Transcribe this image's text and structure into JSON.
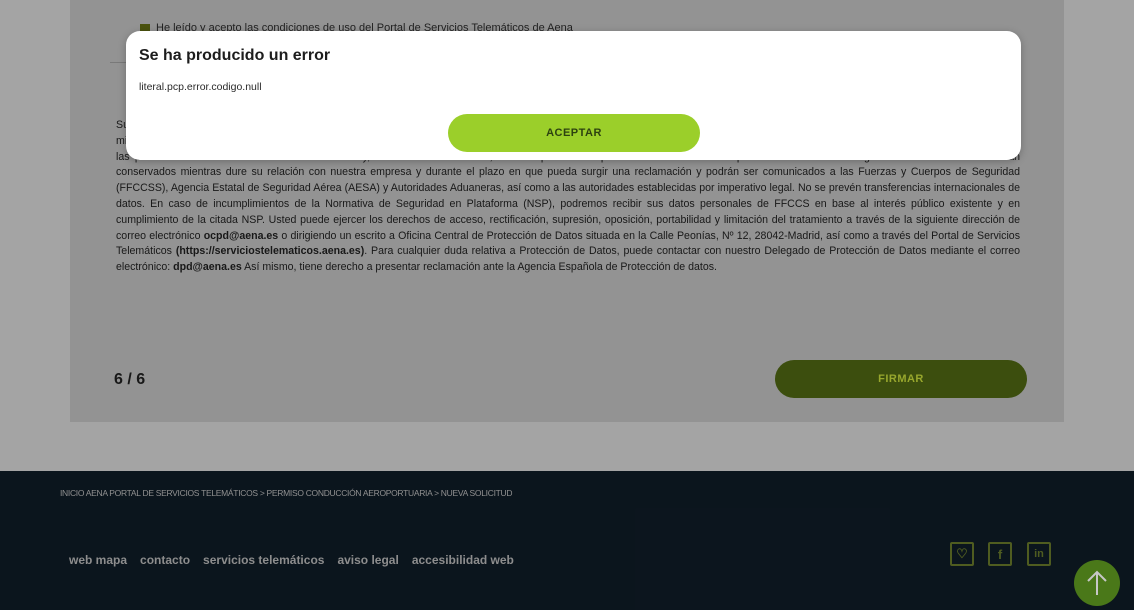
{
  "consent": {
    "checkbox_text": "He leído y acepto las condiciones de uso del Portal de Servicios Telemáticos de Aena"
  },
  "legal_text": {
    "p1": "Sus datos personales serán tratados por AENA S.M.E., S.A. como responsable del tratamiento, con la finalidad de gestionar la solicitud de su PCA y la documentación complementaria al mismo, con la finalidad de gestión y emisión de los PCA y créditos de conducción Aeroportuaria, necesarios para la correcta ejecución de su contrato laboral con AENA, S.M.E., S.A. o bien de las presentes condiciones de utilización del PCA y, en determinados casos, también para el cumplimiento de la normativa aplicable en materia de seguridad aérea. Los datos serán conservados mientras dure su relación con nuestra empresa y durante el plazo en que pueda surgir una reclamación y podrán ser comunicados a las Fuerzas y Cuerpos de Seguridad (FFCCSS), Agencia Estatal de Seguridad Aérea (AESA) y Autoridades Aduaneras, así como a las autoridades establecidas por imperativo legal. No se prevén transferencias internacionales de datos. En caso de incumplimientos de la Normativa de Seguridad en Plataforma (NSP), podremos recibir sus datos personales de FFCCS en base al interés público existente y en cumplimiento de la citada NSP. Usted puede ejercer los derechos de acceso, rectificación, supresión, oposición, portabilidad y limitación del tratamiento a través de la siguiente dirección de correo electrónico ",
    "email1": "ocpd@aena.es",
    "p2": " o dirigiendo un escrito a Oficina Central de Protección de Datos situada en la Calle Peonías, Nº 12, 28042-Madrid, así como a través del Portal de Servicios Telemáticos ",
    "portal_url": "(https://serviciostelematicos.aena.es)",
    "p3": ". Para cualquier duda relativa a Protección de Datos, puede contactar con nuestro Delegado de Protección de Datos mediante el correo electrónico: ",
    "email2": "dpd@aena.es",
    "p4": " Así mismo, tiene derecho a presentar reclamación ante la Agencia Española de Protección de datos."
  },
  "pager": {
    "label": "6 / 6"
  },
  "actions": {
    "sign_label": "FIRMAR"
  },
  "footer": {
    "breadcrumb": "INICIO AENA PORTAL DE SERVICIOS TELEMÁTICOS  >  PERMISO CONDUCCIÓN AEROPORTUARIA  >  NUEVA SOLICITUD",
    "links": [
      "web mapa",
      "contacto",
      "servicios telemáticos",
      "aviso legal",
      "accesibilidad web"
    ],
    "social_icons": [
      "heart-icon",
      "facebook-icon",
      "linkedin-icon"
    ],
    "social_glyphs": [
      "♡",
      "f",
      "in"
    ],
    "accent_color": "#66772a"
  },
  "modal": {
    "title": "Se ha producido un error",
    "message": "literal.pcp.error.codigo.null",
    "accept_label": "ACEPTAR",
    "accept_color": "#9bcf2a"
  }
}
